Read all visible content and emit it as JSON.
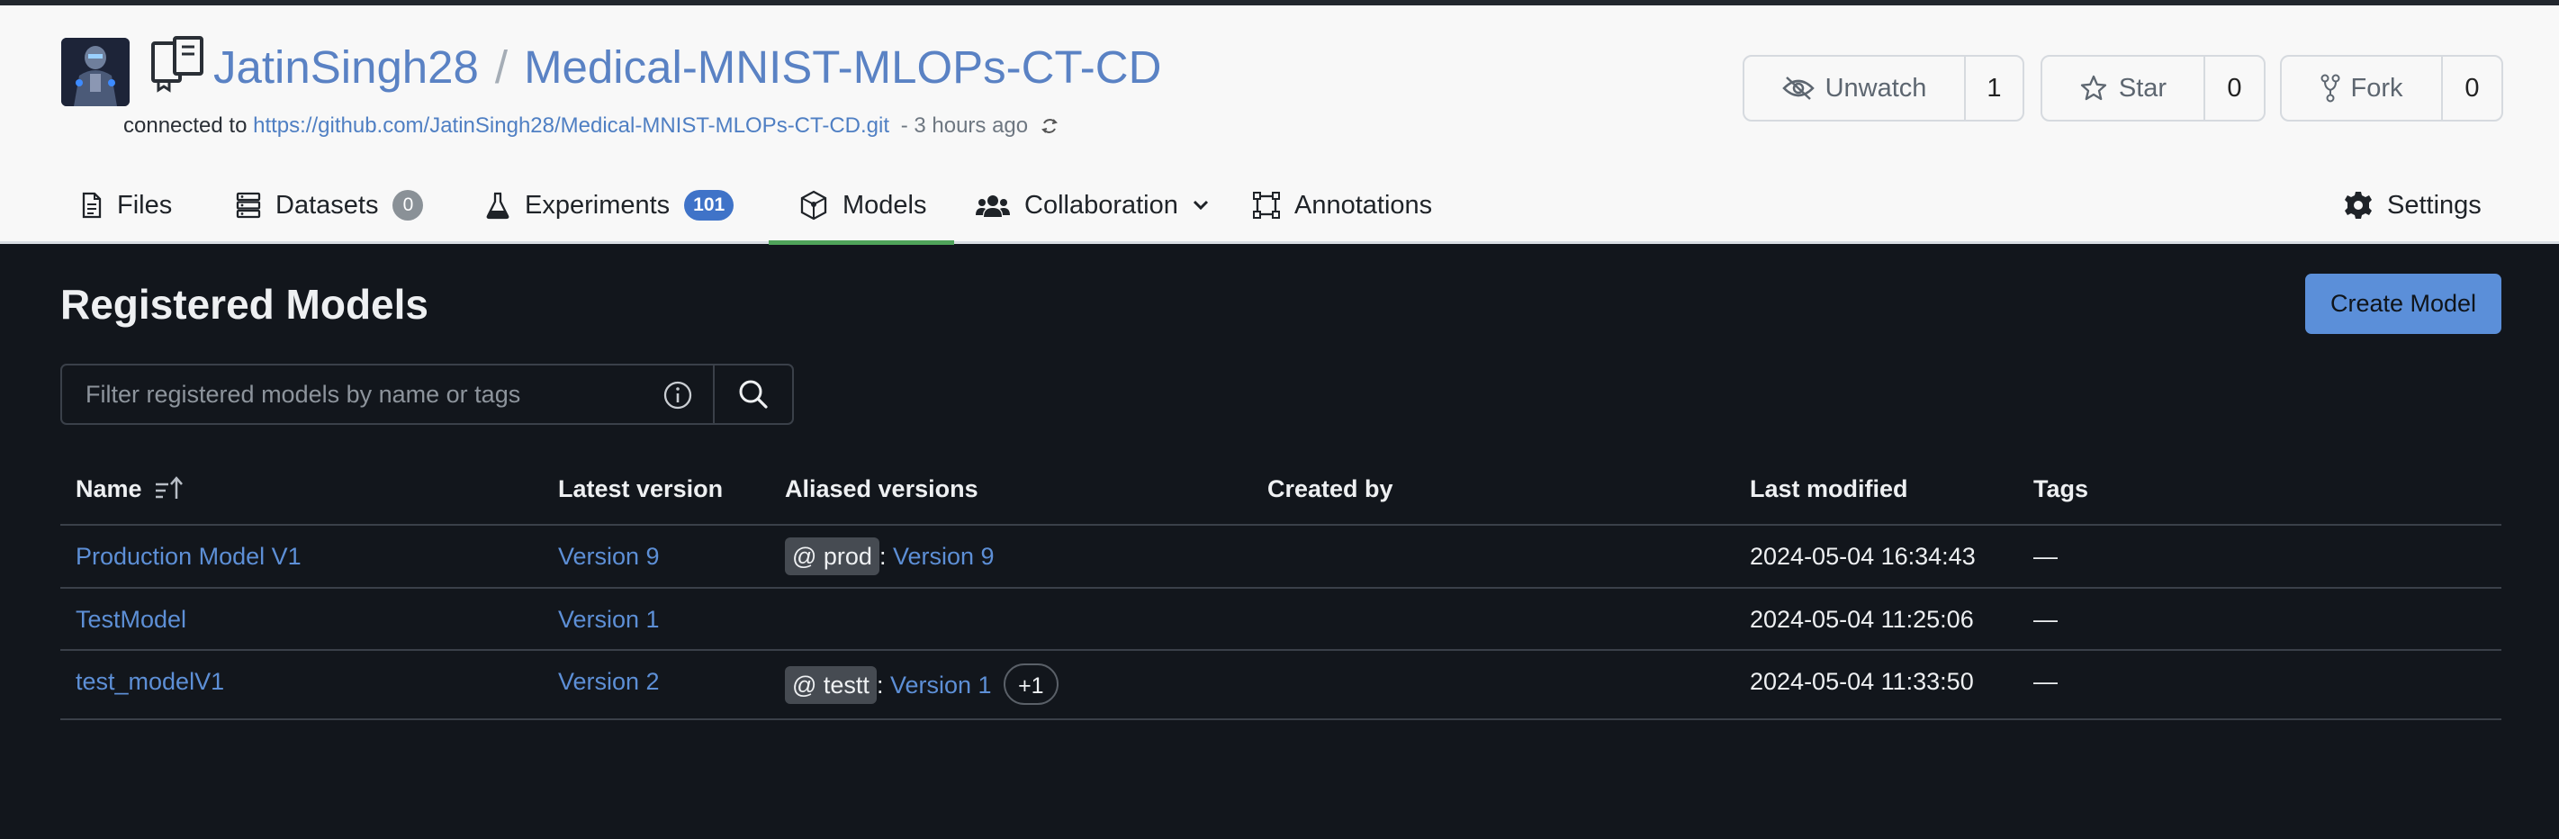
{
  "repo": {
    "owner": "JatinSingh28",
    "separator": "/",
    "name": "Medical-MNIST-MLOPs-CT-CD",
    "connected_prefix": "connected to",
    "connected_url": "https://github.com/JatinSingh28/Medical-MNIST-MLOPs-CT-CD.git",
    "last_sync": "- 3 hours ago"
  },
  "actions": {
    "unwatch": {
      "label": "Unwatch",
      "count": "1"
    },
    "star": {
      "label": "Star",
      "count": "0"
    },
    "fork": {
      "label": "Fork",
      "count": "0"
    }
  },
  "tabs": {
    "files": "Files",
    "datasets": "Datasets",
    "datasets_count": "0",
    "experiments": "Experiments",
    "experiments_count": "101",
    "models": "Models",
    "collaboration": "Collaboration",
    "annotations": "Annotations",
    "settings": "Settings",
    "active": "Models"
  },
  "page": {
    "title": "Registered Models",
    "create_button": "Create Model",
    "search_placeholder": "Filter registered models by name or tags"
  },
  "table": {
    "headers": {
      "name": "Name",
      "latest_version": "Latest version",
      "aliased_versions": "Aliased versions",
      "created_by": "Created by",
      "last_modified": "Last modified",
      "tags": "Tags"
    },
    "rows": [
      {
        "name": "Production Model V1",
        "latest_version": "Version 9",
        "alias": "@ prod",
        "alias_version": "Version 9",
        "extra": "",
        "created_by": "",
        "last_modified": "2024-05-04 16:34:43",
        "tags": "—"
      },
      {
        "name": "TestModel",
        "latest_version": "Version 1",
        "alias": "",
        "alias_version": "",
        "extra": "",
        "created_by": "",
        "last_modified": "2024-05-04 11:25:06",
        "tags": "—"
      },
      {
        "name": "test_modelV1",
        "latest_version": "Version 2",
        "alias": "@ testt",
        "alias_version": "Version 1",
        "extra": "+1",
        "created_by": "",
        "last_modified": "2024-05-04 11:33:50",
        "tags": "—"
      }
    ]
  },
  "colors": {
    "header_bg": "#f8f8f8",
    "body_bg": "#12161c",
    "link": "#5d8fd6",
    "primary_button": "#5b8fd9",
    "active_tab_underline": "#4fa35a",
    "experiments_badge": "#3f73c8"
  }
}
